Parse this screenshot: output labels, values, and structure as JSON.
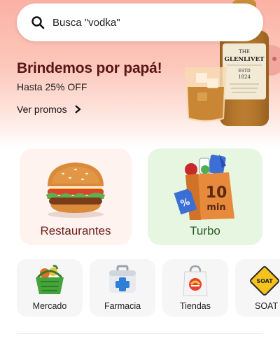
{
  "search": {
    "placeholder": "Busca \"vodka\""
  },
  "promo": {
    "title": "Brindemos por papá!",
    "subtitle": "Hasta 25% OFF",
    "link_label": "Ver promos",
    "bottle_label_top": "THE",
    "bottle_label_brand": "GLENLIVET",
    "bottle_label_estd": "ESTD",
    "bottle_label_year": "1824"
  },
  "categories_main": [
    {
      "label": "Restaurantes",
      "icon": "burger-icon"
    },
    {
      "label": "Turbo",
      "icon": "turbo-bag-icon",
      "badge_big": "10",
      "badge_small": "min",
      "pct": "%"
    }
  ],
  "categories_small": [
    {
      "label": "Mercado",
      "icon": "basket-icon"
    },
    {
      "label": "Farmacia",
      "icon": "first-aid-kit-icon"
    },
    {
      "label": "Tiendas",
      "icon": "shopping-bag-icon"
    },
    {
      "label": "SOAT",
      "icon": "soat-sign-icon",
      "sign_text": "SOAT"
    }
  ],
  "colors": {
    "hero_top": "#fbb1a4",
    "promo_title": "#5a1614",
    "restaurant_card": "#fff3ef",
    "turbo_card": "#e6f6e0"
  }
}
